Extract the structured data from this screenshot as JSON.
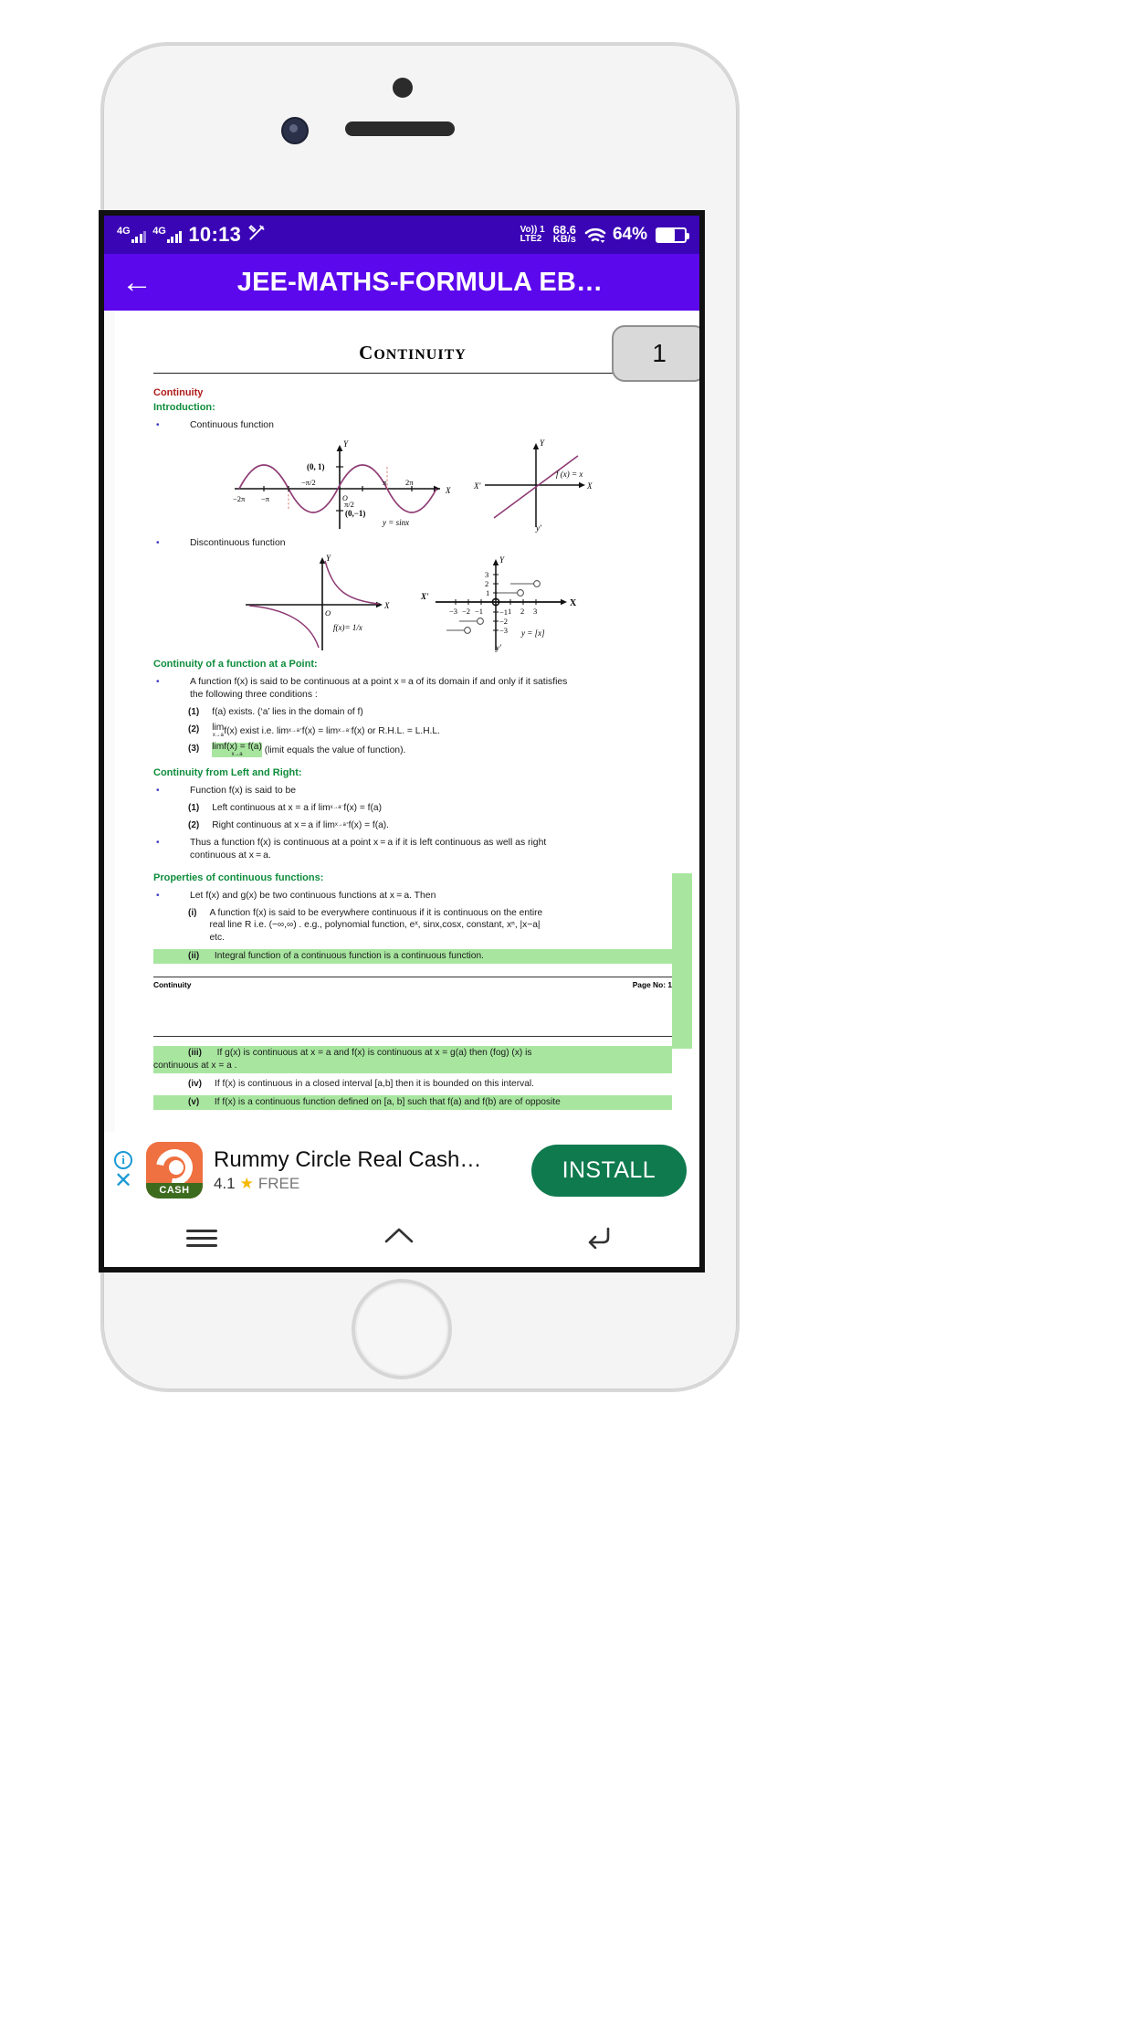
{
  "status_bar": {
    "network_label_1": "4G",
    "network_label_2": "4G",
    "time": "10:13",
    "tools_icon": "tools-icon",
    "volte_line1": "Vo)) 1",
    "volte_line2": "LTE2",
    "data_rate_value": "68.6",
    "data_rate_unit": "KB/s",
    "wifi_icon": "wifi-icon",
    "battery_percent": "64%",
    "battery_icon": "battery-icon"
  },
  "app_bar": {
    "back_icon": "back-arrow-icon",
    "title": "JEE-MATHS-FORMULA EB…"
  },
  "viewer": {
    "page_badge": "1"
  },
  "document": {
    "heading": "CONTINUITY",
    "heading_first": "C",
    "heading_rest": "ONTINUITY",
    "section_continuity": "Continuity",
    "section_introduction": "Introduction:",
    "bullet_continuous": "Continuous function",
    "bullet_discontinuous": "Discontinuous function",
    "graphs": {
      "sine": {
        "axis_x": "X",
        "axis_y": "Y",
        "origin": "O",
        "label_point_top": "(0, 1)",
        "label_point_bottom": "(0,−1)",
        "tick_neg_2pi": "−2π",
        "tick_neg_pi": "−π",
        "tick_neg_pi_2": "−π/2",
        "tick_pi_2": "π/2",
        "tick_pi": "π",
        "tick_2pi": "2π",
        "curve_label": "y = sinx"
      },
      "identity": {
        "axis_x": "X",
        "axis_x_neg": "X'",
        "axis_y": "Y",
        "axis_y_neg": "y'",
        "curve_label": "f (x) = x"
      },
      "reciprocal": {
        "axis_x": "X",
        "axis_y": "Y",
        "origin": "O",
        "curve_label": "f(x)= 1/x"
      },
      "floor": {
        "axis_x": "X",
        "axis_x_neg": "X'",
        "axis_y": "Y",
        "axis_y_neg": "y'",
        "origin": "O",
        "y_ticks": [
          "3",
          "2",
          "1",
          "−1",
          "−2",
          "−3"
        ],
        "x_ticks": [
          "−3",
          "−2",
          "−1",
          "1",
          "2",
          "3"
        ],
        "curve_label": "y = [x]"
      }
    },
    "heading_point": "Continuity of a function at a Point:",
    "point_intro_a": "A function  f(x)  is said to be continuous at a point  x = a  of its domain if and only if it satisfies",
    "point_intro_b": "the following three conditions :",
    "point_1_num": "(1)",
    "point_1_text": "f(a)  exists. (‘a’ lies in the domain of f)",
    "point_2_num": "(2)",
    "point_2_text_a": "lim",
    "point_2_sub_a": "x→a",
    "point_2_text_b": "f(x)  exist i.e.  lim",
    "point_2_sub_b": "x→a⁺",
    "point_2_text_c": "f(x) = lim",
    "point_2_sub_c": "x→a⁻",
    "point_2_text_d": "f(x) or R.H.L. = L.H.L.",
    "point_3_num": "(3)",
    "point_3_hl": "limf(x) = f(a)",
    "point_3_sub": "x→a",
    "point_3_text": "(limit equals the value of function).",
    "heading_left_right": "Continuity from Left and Right:",
    "lr_intro": "Function  f(x)  is said to be",
    "lr_1_num": "(1)",
    "lr_1_text_a": "Left continuous at x = a if  lim",
    "lr_1_sub": "x→a⁻",
    "lr_1_text_b": "f(x) = f(a)",
    "lr_2_num": "(2)",
    "lr_2_text_a": "Right continuous at  x = a  if  lim",
    "lr_2_sub": "x→a⁺",
    "lr_2_text_b": "f(x) = f(a).",
    "lr_thus_a": "Thus a function  f(x)  is continuous at a point  x = a  if it is left continuous as well as right",
    "lr_thus_b": "continuous at  x = a.",
    "heading_properties": "Properties of continuous functions:",
    "prop_intro": "Let  f(x)  and  g(x)  be two continuous functions at  x = a. Then",
    "prop_i_num": "(i)",
    "prop_i_text_a": "A function  f(x)  is said to be everywhere continuous if it is continuous on the entire",
    "prop_i_text_b": "real line R i.e. (−∞,∞) . e.g., polynomial function, eˣ, sinx,cosx, constant, xⁿ,  |x−a|",
    "prop_i_text_c": "etc.",
    "prop_ii_num": "(ii)",
    "prop_ii_text": "Integral function of a continuous function is a continuous function.",
    "footer_left": "Continuity",
    "footer_right": "Page No: 1",
    "prop_iii_num": "(iii)",
    "prop_iii_text_a": "If g(x) is continuous at x = a   and f(x) is continuous at x = g(a)   then (fog) (x) is",
    "prop_iii_text_b": "continuous at x = a .",
    "prop_iv_num": "(iv)",
    "prop_iv_text": "If f(x) is continuous in a closed interval [a,b] then it is bounded on this interval.",
    "prop_v_num": "(v)",
    "prop_v_text": "If f(x) is a continuous function defined on [a, b] such that f(a) and f(b) are of opposite"
  },
  "ad": {
    "info_icon": "info-icon",
    "close_icon": "close-icon",
    "app_icon_label": "CASH",
    "title": "Rummy Circle Real Cash…",
    "rating": "4.1",
    "star_icon": "star-icon",
    "price": "FREE",
    "install_label": "INSTALL"
  },
  "nav_bar": {
    "menu_icon": "menu-icon",
    "home_icon": "home-icon",
    "back_icon": "back-icon"
  },
  "colors": {
    "statusbar": "#3a05b5",
    "appbar": "#5c08ec",
    "highlight": "#a8e6a0",
    "heading_green": "#0f8d3c",
    "heading_red": "#b01c1c",
    "install_green": "#0f7a4e"
  }
}
